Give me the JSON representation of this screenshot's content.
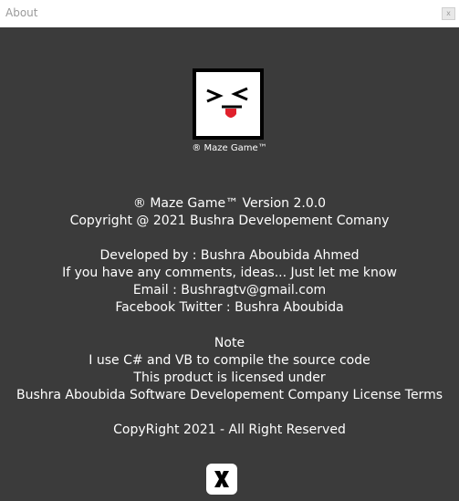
{
  "window": {
    "title": "About",
    "close_glyph": "x"
  },
  "logo": {
    "icon": "maze-face-logo",
    "caption": "® Maze Game™"
  },
  "version_info": {
    "line1": "® Maze Game™  Version 2.0.0",
    "line2": "Copyright @ 2021 Bushra Developement Comany"
  },
  "developer_info": {
    "line1": "Developed by : Bushra Aboubida Ahmed",
    "line2": "If you have any comments, ideas... Just let me know",
    "line3": "Email : Bushragtv@gmail.com",
    "line4": "Facebook  Twitter : Bushra Aboubida"
  },
  "note": {
    "heading": "Note",
    "line1": "I use C# and VB to compile the source code",
    "line2": "This product is licensed under",
    "line3": "Bushra Aboubida Software Developement Company License Terms"
  },
  "copyright": "CopyRight 2021 - All Right Reserved",
  "colors": {
    "background": "#3b3b3b",
    "text": "#ffffff",
    "titlebar": "#ffffff"
  }
}
